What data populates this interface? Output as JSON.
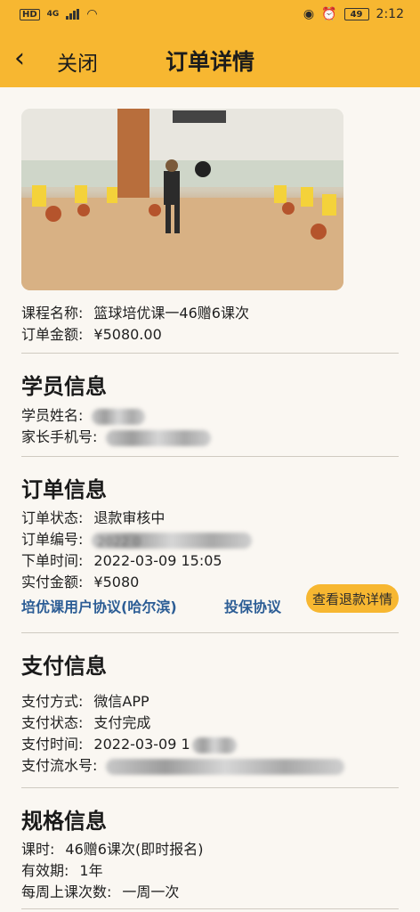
{
  "status_bar": {
    "left_text": "HD",
    "net": "4G",
    "battery": "49",
    "time": "2:12"
  },
  "nav": {
    "back_glyph": "‹",
    "close_label": "关闭",
    "title": "订单详情"
  },
  "course": {
    "name_label": "课程名称:",
    "name_value": "篮球培优课一46赠6课次",
    "amount_label": "订单金额:",
    "amount_value": "¥5080.00"
  },
  "student": {
    "title": "学员信息",
    "name_label": "学员姓名:",
    "phone_label": "家长手机号:"
  },
  "order": {
    "title": "订单信息",
    "status_label": "订单状态:",
    "status_value": "退款审核中",
    "number_label": "订单编号:",
    "number_partial": "2022 0",
    "time_label": "下单时间:",
    "time_value": "2022-03-09 15:05",
    "paid_label": "实付金额:",
    "paid_value": "¥5080",
    "link_agreement": "培优课用户协议(哈尔滨)",
    "link_insurance": "投保协议",
    "refund_button": "查看退款详情"
  },
  "payment": {
    "title": "支付信息",
    "method_label": "支付方式:",
    "method_value": "微信APP",
    "status_label": "支付状态:",
    "status_value": "支付完成",
    "time_label": "支付时间:",
    "time_value": "2022-03-09 1",
    "serial_label": "支付流水号:"
  },
  "spec": {
    "title": "规格信息",
    "lessons_label": "课时:",
    "lessons_value": "46赠6课次(即时报名)",
    "validity_label": "有效期:",
    "validity_value": "1年",
    "weekly_label": "每周上课次数:",
    "weekly_value": "一周一次"
  },
  "colors": {
    "accent": "#f7b731",
    "link": "#2c5d95",
    "background": "#faf7f2"
  }
}
